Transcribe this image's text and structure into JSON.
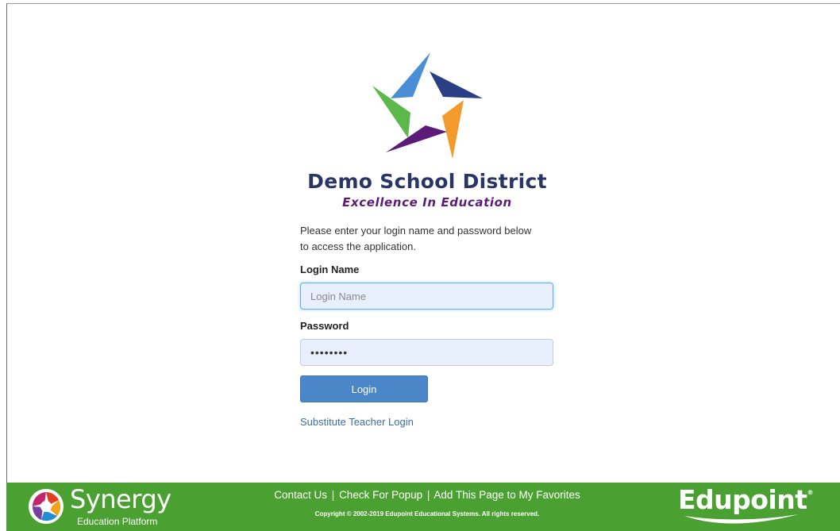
{
  "branding": {
    "district_name": "Demo School District",
    "tagline": "Excellence In Education",
    "logo_icon": "star-logo-icon",
    "colors": {
      "district_name": "#2a3567",
      "tagline": "#5b1c77",
      "star_blue": "#4a8fd6",
      "star_navy": "#2b3f84",
      "star_green": "#5cb84a",
      "star_orange": "#f29b2c",
      "star_purple": "#5b1c77"
    }
  },
  "login_form": {
    "instructions": "Please enter your login name and password below to access the application.",
    "login_label": "Login Name",
    "login_placeholder": "Login Name",
    "login_value": "",
    "password_label": "Password",
    "password_value": "••••••••",
    "login_button": "Login",
    "substitute_link": "Substitute Teacher Login",
    "colors": {
      "button": "#4a86c8",
      "input_fill": "#e8f0fe",
      "link": "#3a6ea5"
    }
  },
  "footer": {
    "synergy_name": "Synergy",
    "synergy_subtitle": "Education Platform",
    "links": [
      "Contact Us",
      "Check For Popup",
      "Add This Page to My Favorites"
    ],
    "link_separator": "|",
    "copyright": "Copyright © 2002-2019 Edupoint Educational Systems. All rights reserved.",
    "edupoint_name": "Edupoint",
    "edupoint_reg": "®",
    "colors": {
      "background": "#4aa132"
    }
  }
}
